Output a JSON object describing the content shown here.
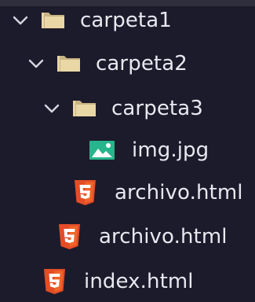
{
  "explorer": {
    "items": [
      {
        "label": "carpeta1",
        "kind": "folder",
        "expanded": true,
        "icon": "folder-icon"
      },
      {
        "label": "carpeta2",
        "kind": "folder",
        "expanded": true,
        "icon": "folder-icon"
      },
      {
        "label": "carpeta3",
        "kind": "folder",
        "expanded": true,
        "icon": "folder-icon"
      },
      {
        "label": "img.jpg",
        "kind": "file",
        "icon": "image-file-icon"
      },
      {
        "label": "archivo.html",
        "kind": "file",
        "icon": "html5-file-icon"
      },
      {
        "label": "archivo.html",
        "kind": "file",
        "icon": "html5-file-icon"
      },
      {
        "label": "index.html",
        "kind": "file",
        "icon": "html5-file-icon"
      }
    ]
  },
  "colors": {
    "background": "#1c1b2b",
    "text": "#e8e8f0",
    "folder": "#e8d6a8",
    "html5": "#e44d26",
    "image": "#26b58c",
    "chevron": "#d6d6e0"
  }
}
